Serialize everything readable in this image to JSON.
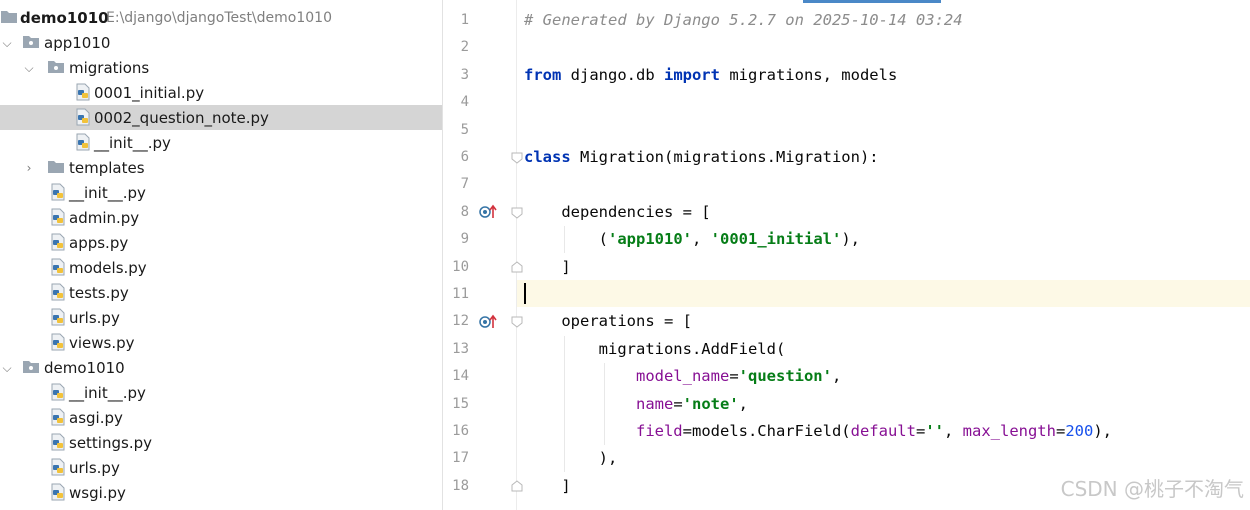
{
  "project": {
    "name": "demo1010",
    "path": "E:\\django\\djangoTest\\demo1010"
  },
  "tree": [
    {
      "label": "app1010",
      "kind": "package"
    },
    {
      "label": "migrations",
      "kind": "package"
    },
    {
      "label": "0001_initial.py",
      "kind": "python-file"
    },
    {
      "label": "0002_question_note.py",
      "kind": "python-file",
      "selected": true
    },
    {
      "label": "__init__.py",
      "kind": "python-file"
    },
    {
      "label": "templates",
      "kind": "folder"
    },
    {
      "label": "__init__.py",
      "kind": "python-file"
    },
    {
      "label": "admin.py",
      "kind": "python-file"
    },
    {
      "label": "apps.py",
      "kind": "python-file"
    },
    {
      "label": "models.py",
      "kind": "python-file"
    },
    {
      "label": "tests.py",
      "kind": "python-file"
    },
    {
      "label": "urls.py",
      "kind": "python-file"
    },
    {
      "label": "views.py",
      "kind": "python-file"
    },
    {
      "label": "demo1010",
      "kind": "package"
    },
    {
      "label": "__init__.py",
      "kind": "python-file"
    },
    {
      "label": "asgi.py",
      "kind": "python-file"
    },
    {
      "label": "settings.py",
      "kind": "python-file"
    },
    {
      "label": "urls.py",
      "kind": "python-file"
    },
    {
      "label": "wsgi.py",
      "kind": "python-file"
    }
  ],
  "editor": {
    "line_numbers": [
      "1",
      "2",
      "3",
      "4",
      "5",
      "6",
      "7",
      "8",
      "9",
      "10",
      "11",
      "12",
      "13",
      "14",
      "15",
      "16",
      "17",
      "18"
    ],
    "current_line": 11,
    "tokens": {
      "l1": "# Generated by Django 5.2.7 on 2025-10-14 03:24",
      "l3_from": "from",
      "l3_mod": " django.db ",
      "l3_import": "import",
      "l3_rest": " migrations, models",
      "l6_class": "class",
      "l6_rest": " Migration(migrations.Migration):",
      "l8": "    dependencies = [",
      "l9_open": "        (",
      "l9_s1": "'app1010'",
      "l9_mid": ", ",
      "l9_s2": "'0001_initial'",
      "l9_close": "),",
      "l10": "    ]",
      "l12": "    operations = [",
      "l13": "        migrations.AddField(",
      "l14_pad": "            ",
      "l14_param": "model_name",
      "l14_eq": "=",
      "l14_str": "'question'",
      "l14_end": ",",
      "l15_pad": "            ",
      "l15_param": "name",
      "l15_eq": "=",
      "l15_str": "'note'",
      "l15_end": ",",
      "l16_pad": "            ",
      "l16_param": "field",
      "l16_mid": "=models.CharField(",
      "l16_param2": "default",
      "l16_eq2": "=",
      "l16_str": "''",
      "l16_comma": ", ",
      "l16_param3": "max_length",
      "l16_eq3": "=",
      "l16_num": "200",
      "l16_end": "),",
      "l17": "        ),",
      "l18": "    ]"
    }
  },
  "watermark": "CSDN @桃子不淘气",
  "colors": {
    "keyword": "#0033b3",
    "string": "#067d17",
    "comment": "#8c8c8c",
    "parameter": "#871094",
    "number": "#1750eb",
    "selection": "#d5d5d5",
    "current_line": "#fdf9e6"
  }
}
